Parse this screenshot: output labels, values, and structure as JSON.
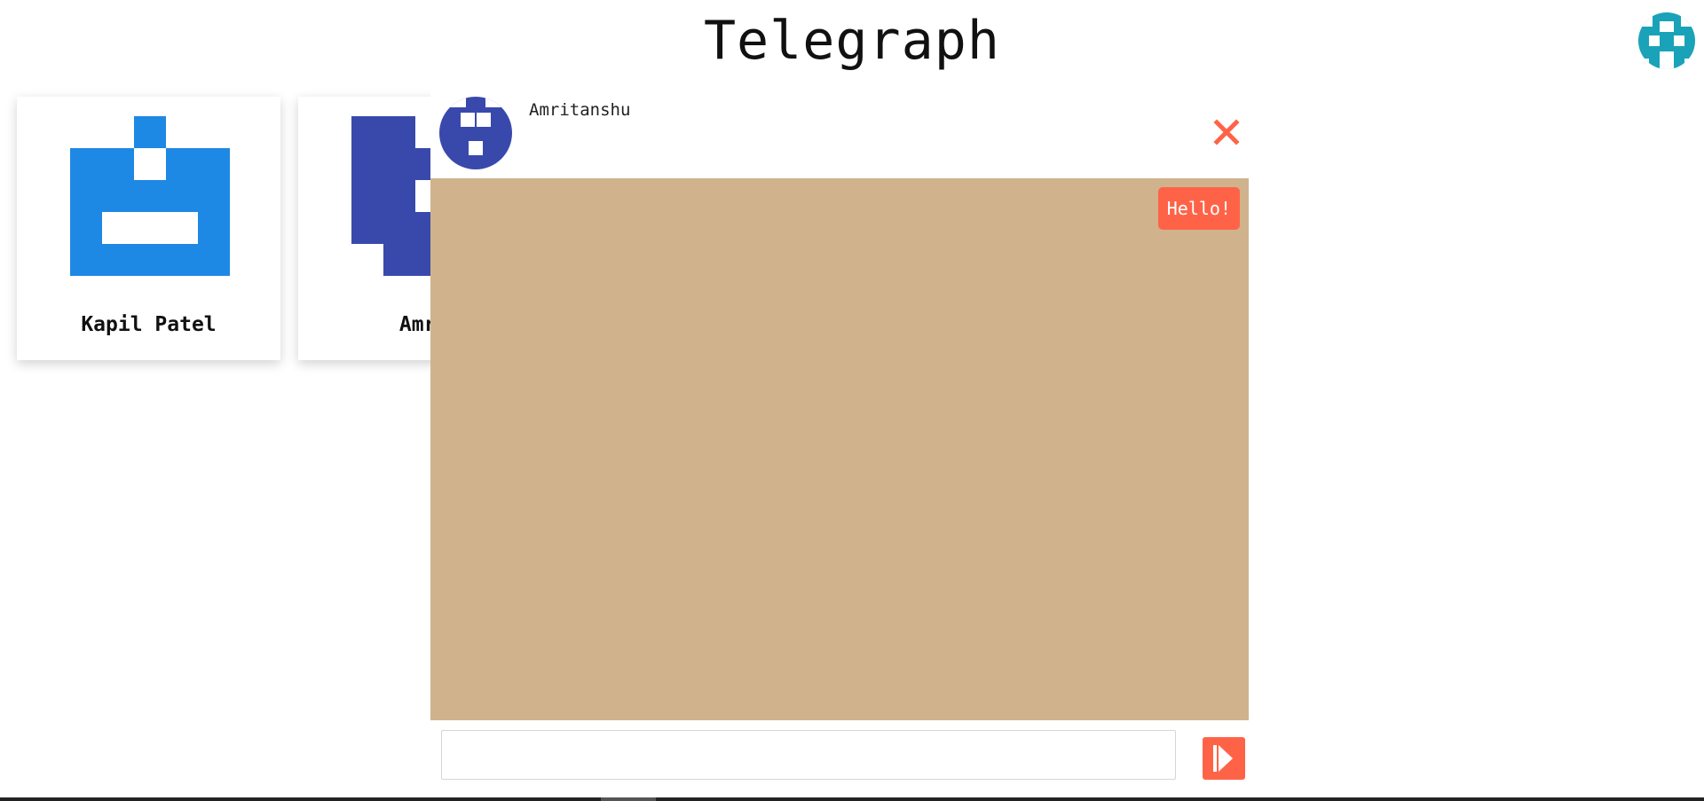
{
  "app": {
    "title": "Telegraph"
  },
  "colors": {
    "accent": "#ff6347",
    "card_blue": "#1e88e5",
    "indigo": "#3949ab",
    "teal": "#1aa3b8",
    "chat_background": "#d0b38c"
  },
  "icons": {
    "user_avatar": "identicon-teal",
    "close": "close-x-icon",
    "send": "play-triangle-icon"
  },
  "contacts": [
    {
      "name": "Kapil Patel",
      "avatar": "identicon-blue"
    },
    {
      "name": "Amritanshu",
      "visible_name": "Amrit",
      "avatar": "identicon-indigo"
    }
  ],
  "chat": {
    "contact_name": "Amritanshu",
    "messages": [
      {
        "text": "Hello!",
        "direction": "outgoing"
      }
    ],
    "input": {
      "value": "",
      "placeholder": ""
    }
  }
}
